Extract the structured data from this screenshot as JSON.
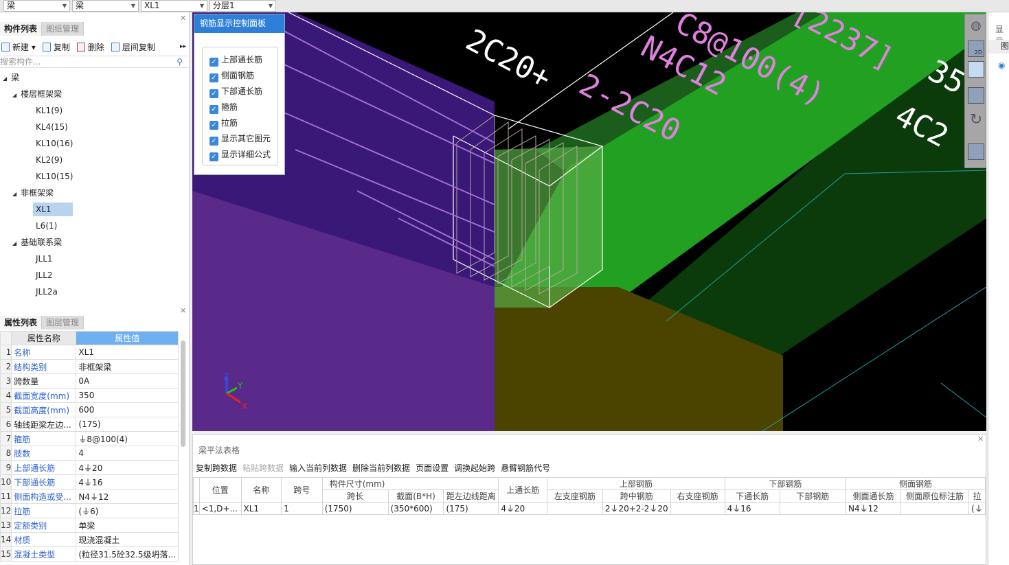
{
  "topbar": {
    "dropdowns": [
      "梁",
      "梁",
      "XL1",
      "分层1"
    ]
  },
  "component_panel": {
    "tabs": [
      "构件列表",
      "图纸管理"
    ],
    "toolbar": [
      "新建",
      "复制",
      "删除",
      "层间复制"
    ],
    "more": "▸▸",
    "search_placeholder": "搜索构件...",
    "tree": [
      {
        "label": "梁",
        "level": 0
      },
      {
        "label": "楼层框架梁",
        "level": 1
      },
      {
        "label": "KL1(9)",
        "level": 2
      },
      {
        "label": "KL4(15)",
        "level": 2
      },
      {
        "label": "KL10(16)",
        "level": 2
      },
      {
        "label": "KL2(9)",
        "level": 2
      },
      {
        "label": "KL10(15)",
        "level": 2
      },
      {
        "label": "非框架梁",
        "level": 1
      },
      {
        "label": "XL1",
        "level": 2,
        "selected": true
      },
      {
        "label": "L6(1)",
        "level": 2
      },
      {
        "label": "基础联系梁",
        "level": 1
      },
      {
        "label": "JLL1",
        "level": 2
      },
      {
        "label": "JLL2",
        "level": 2
      },
      {
        "label": "JLL2a",
        "level": 2
      }
    ]
  },
  "property_panel": {
    "tabs": [
      "属性列表",
      "图层管理"
    ],
    "headers": [
      "属性名称",
      "属性值"
    ],
    "rows": [
      {
        "num": "1",
        "name": "名称",
        "value": "XL1",
        "blue": true
      },
      {
        "num": "2",
        "name": "结构类别",
        "value": "非框架梁",
        "blue": true
      },
      {
        "num": "3",
        "name": "跨数量",
        "value": "0A",
        "blue": false
      },
      {
        "num": "4",
        "name": "截面宽度(mm)",
        "value": "350",
        "blue": true
      },
      {
        "num": "5",
        "name": "截面高度(mm)",
        "value": "600",
        "blue": true
      },
      {
        "num": "6",
        "name": "轴线距梁左边...",
        "value": "(175)",
        "blue": false
      },
      {
        "num": "7",
        "name": "箍筋",
        "value": "⏚8@100(4)",
        "blue": true
      },
      {
        "num": "8",
        "name": "肢数",
        "value": "4",
        "blue": true
      },
      {
        "num": "9",
        "name": "上部通长筋",
        "value": "4⏚20",
        "blue": true
      },
      {
        "num": "10",
        "name": "下部通长筋",
        "value": "4⏚16",
        "blue": true
      },
      {
        "num": "11",
        "name": "侧面构造或受...",
        "value": "N4⏚12",
        "blue": true
      },
      {
        "num": "12",
        "name": "拉筋",
        "value": "(⏚6)",
        "blue": true
      },
      {
        "num": "13",
        "name": "定额类别",
        "value": "单梁",
        "blue": true
      },
      {
        "num": "14",
        "name": "材质",
        "value": "现浇混凝土",
        "blue": true
      },
      {
        "num": "15",
        "name": "混凝土类型",
        "value": "(粒径31.5砼32.5级坍落...",
        "blue": true
      }
    ]
  },
  "rebar_panel": {
    "title": "钢筋显示控制面板",
    "items": [
      "上部通长筋",
      "侧面钢筋",
      "下部通长筋",
      "箍筋",
      "拉筋",
      "显示其它图元",
      "显示详细公式"
    ]
  },
  "viewport": {
    "annotations": {
      "a1": "2C20+",
      "a2": "2-2C20",
      "a3": "N4C12",
      "a4": "C8@100(4)",
      "a5": "[2237]",
      "a6": "35",
      "a7": "4C2"
    },
    "axes": {
      "x": "X",
      "y": "Y",
      "z": "Z"
    },
    "colors": {
      "green": "#22a022",
      "purple": "#5a2a8a",
      "olive": "#4a4400"
    }
  },
  "view_toolbar": {
    "btn_2d": "2D"
  },
  "right_panel": {
    "title": "显示",
    "tab": "图"
  },
  "bottom": {
    "title": "梁平法表格",
    "toolbar": [
      {
        "label": "复制跨数据",
        "disabled": false
      },
      {
        "label": "粘贴跨数据",
        "disabled": true
      },
      {
        "label": "输入当前列数据",
        "disabled": false
      },
      {
        "label": "删除当前列数据",
        "disabled": false
      },
      {
        "label": "页面设置",
        "disabled": false
      },
      {
        "label": "调换起始跨",
        "disabled": false
      },
      {
        "label": "悬臂钢筋代号",
        "disabled": false
      }
    ],
    "groups": {
      "size": "构件尺寸(mm)",
      "top": "上部钢筋",
      "bottom": "下部钢筋",
      "side": "侧面钢筋"
    },
    "headers": {
      "pos": "位置",
      "name": "名称",
      "span": "跨号",
      "len": "跨长",
      "sec": "截面(B*H)",
      "dist": "距左边线距离",
      "topcont": "上通长筋",
      "left": "左支座钢筋",
      "mid": "跨中钢筋",
      "right": "右支座钢筋",
      "botcont": "下通长筋",
      "bot": "下部钢筋",
      "sidecont": "侧面通长筋",
      "sideorig": "侧面原位标注筋",
      "tie": "拉"
    },
    "rows": [
      {
        "num": "1",
        "pos": "<1,D+...",
        "name": "XL1",
        "span": "1",
        "len": "(1750)",
        "sec": "(350*600)",
        "dist": "(175)",
        "topcont": "4⏚20",
        "left": "",
        "mid": "2⏚20+2-2⏚20",
        "right": "",
        "botcont": "4⏚16",
        "bot": "",
        "sidecont": "N4⏚12",
        "sideorig": "",
        "tie": "(⏚"
      }
    ]
  }
}
